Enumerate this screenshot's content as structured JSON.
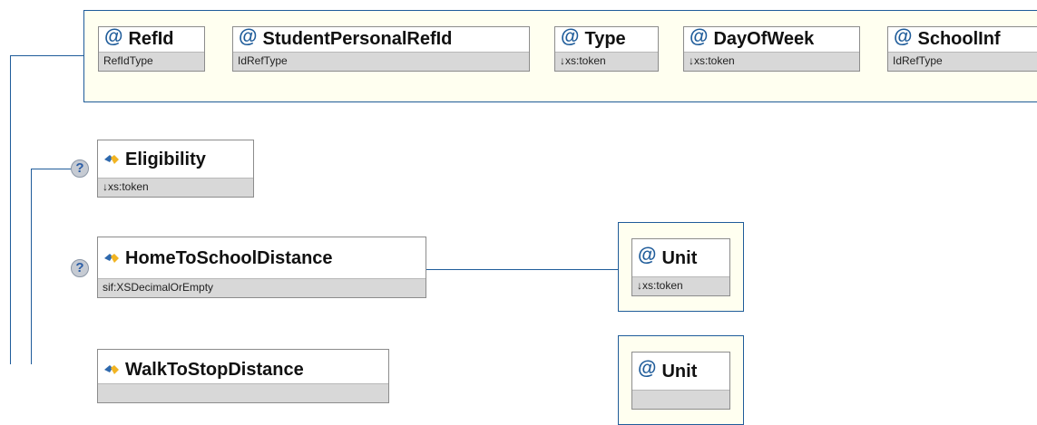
{
  "attributes": [
    {
      "name": "RefId",
      "type": "RefIdType"
    },
    {
      "name": "StudentPersonalRefId",
      "type": "IdRefType"
    },
    {
      "name": "Type",
      "type": "↓xs:token"
    },
    {
      "name": "DayOfWeek",
      "type": "↓xs:token"
    },
    {
      "name": "SchoolInf",
      "type": "IdRefType"
    }
  ],
  "elements": {
    "eligibility": {
      "name": "Eligibility",
      "type": "↓xs:token"
    },
    "home_to_school_distance": {
      "name": "HomeToSchoolDistance",
      "type": "sif:XSDecimalOrEmpty"
    },
    "walk_to_stop_distance": {
      "name": "WalkToStopDistance",
      "type": ""
    }
  },
  "unit_attributes": [
    {
      "name": "Unit",
      "type": "↓xs:token"
    },
    {
      "name": "Unit",
      "type": ""
    }
  ],
  "icons": {
    "attribute": "at-sign-icon",
    "element": "element-icon",
    "optional": "question-mark-icon"
  },
  "optional_symbol": "?",
  "at_symbol": "@",
  "colors": {
    "connector": "#1f5c9a",
    "attribute_group_bg": "#fffff0",
    "type_bar": "#d8d8d8"
  }
}
